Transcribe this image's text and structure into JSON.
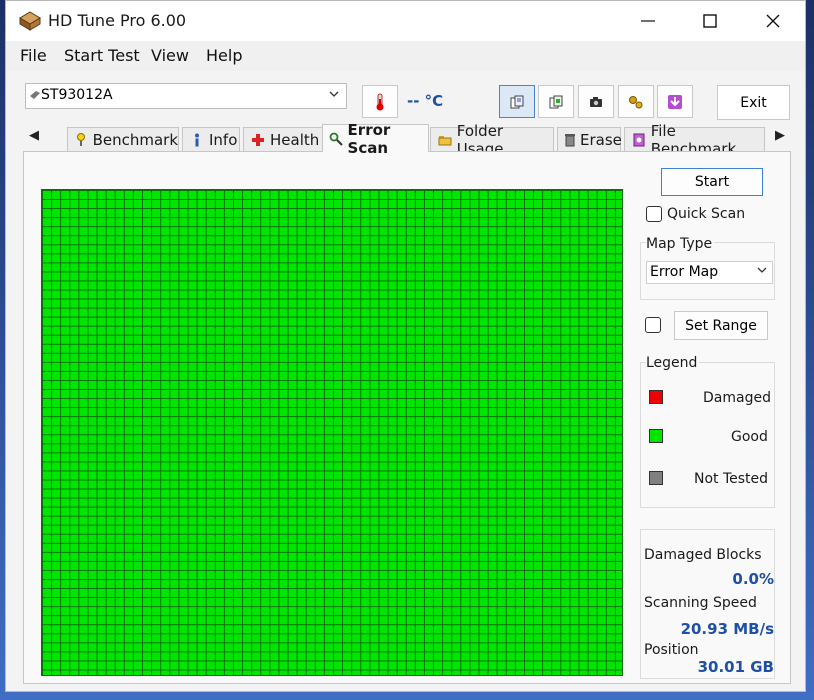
{
  "window": {
    "title": "HD Tune Pro 6.00"
  },
  "menu": [
    "File",
    "Start Test",
    "View",
    "Help"
  ],
  "toolbar": {
    "drive": "ST93012A",
    "temperature": "-- °C",
    "exit_label": "Exit",
    "buttons": [
      "copy-text-icon",
      "copy-screenshot-icon",
      "camera-icon",
      "options-icon",
      "save-icon"
    ]
  },
  "tabs": {
    "items": [
      {
        "label": "Benchmark",
        "icon": "benchmark-icon",
        "active": false
      },
      {
        "label": "Info",
        "icon": "info-icon",
        "active": false
      },
      {
        "label": "Health",
        "icon": "health-icon",
        "active": false
      },
      {
        "label": "Error Scan",
        "icon": "magnifier-icon",
        "active": true
      },
      {
        "label": "Folder Usage",
        "icon": "folder-icon",
        "active": false
      },
      {
        "label": "Erase",
        "icon": "trash-icon",
        "active": false
      },
      {
        "label": "File Benchmark",
        "icon": "file-benchmark-icon",
        "active": false
      }
    ]
  },
  "scan": {
    "start_label": "Start",
    "quick_scan_label": "Quick Scan",
    "quick_scan_checked": false,
    "map_type_label": "Map Type",
    "map_type_value": "Error Map",
    "set_range_label": "Set Range",
    "set_range_checked": false,
    "map_state": "all good"
  },
  "legend": {
    "title": "Legend",
    "items": [
      {
        "label": "Damaged",
        "color": "#f00000"
      },
      {
        "label": "Good",
        "color": "#00e600"
      },
      {
        "label": "Not Tested",
        "color": "#808080"
      }
    ]
  },
  "stats": {
    "damaged_label": "Damaged Blocks",
    "damaged_value": "0.0%",
    "speed_label": "Scanning Speed",
    "speed_value": "20.93 MB/s",
    "position_label": "Position",
    "position_value": "30.01 GB"
  },
  "colors": {
    "accent_text": "#1f4fa7",
    "good": "#00e600",
    "grid_line": "#0b6e0b"
  }
}
